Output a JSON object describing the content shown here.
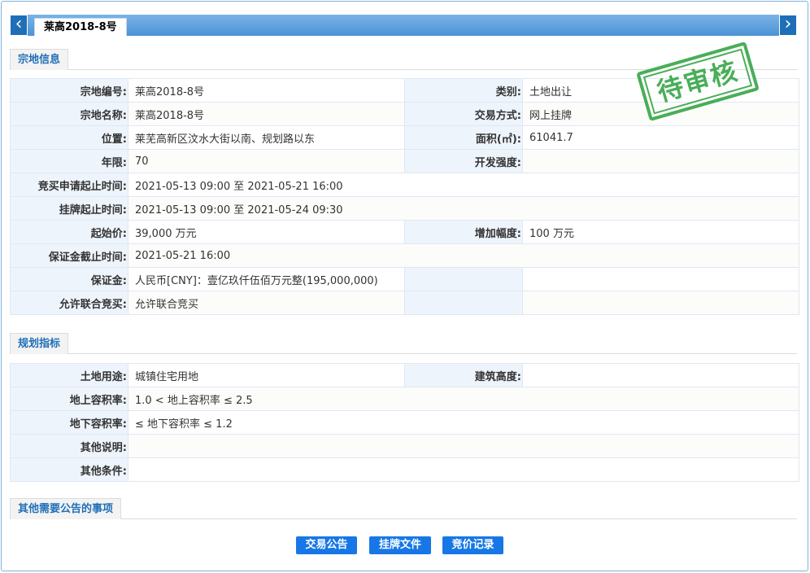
{
  "tabbar": {
    "prev_icon": "‹",
    "next_icon": "›",
    "active_tab": "莱高2018-8号"
  },
  "sections": {
    "parcel": "宗地信息",
    "planning": "规划指标",
    "other": "其他需要公告的事项"
  },
  "stamp": {
    "text": "待审核",
    "color": "#3aa84a"
  },
  "parcel": {
    "rows": [
      {
        "l1": "宗地编号:",
        "v1": "莱高2018-8号",
        "l2": "类别:",
        "v2": "土地出让"
      },
      {
        "l1": "宗地名称:",
        "v1": "莱高2018-8号",
        "l2": "交易方式:",
        "v2": "网上挂牌"
      },
      {
        "l1": "位置:",
        "v1": "莱芜高新区汶水大街以南、规划路以东",
        "l2": "面积(㎡):",
        "v2": "61041.7"
      },
      {
        "l1": "年限:",
        "v1": "70",
        "l2": "开发强度:",
        "v2": ""
      }
    ],
    "apply_time_label": "竞买申请起止时间:",
    "apply_time": "2021-05-13 09:00 至 2021-05-21 16:00",
    "listing_time_label": "挂牌起止时间:",
    "listing_time": "2021-05-13 09:00 至 2021-05-24 09:30",
    "start_price_label": "起始价:",
    "start_price": "39,000 万元",
    "increment_label": "增加幅度:",
    "increment": "100 万元",
    "deposit_deadline_label": "保证金截止时间:",
    "deposit_deadline": "2021-05-21 16:00",
    "deposit_label": "保证金:",
    "deposit": "人民币[CNY]：壹亿玖仟伍佰万元整(195,000,000)",
    "joint_label": "允许联合竞买:",
    "joint": "允许联合竞买"
  },
  "planning": {
    "use_label": "土地用途:",
    "use": "城镇住宅用地",
    "height_label": "建筑高度:",
    "height": "",
    "far_above_label": "地上容积率:",
    "far_above": "1.0 < 地上容积率 ≤ 2.5",
    "far_below_label": "地下容积率:",
    "far_below": "≤ 地下容积率 ≤ 1.2",
    "other_desc_label": "其他说明:",
    "other_desc": "",
    "other_cond_label": "其他条件:",
    "other_cond": ""
  },
  "buttons": {
    "notice": "交易公告",
    "listing_docs": "挂牌文件",
    "bid_record": "竞价记录"
  },
  "colors": {
    "accent": "#1777e6",
    "label_bg": "#eef4fb",
    "section_text": "#1f6fb8"
  }
}
